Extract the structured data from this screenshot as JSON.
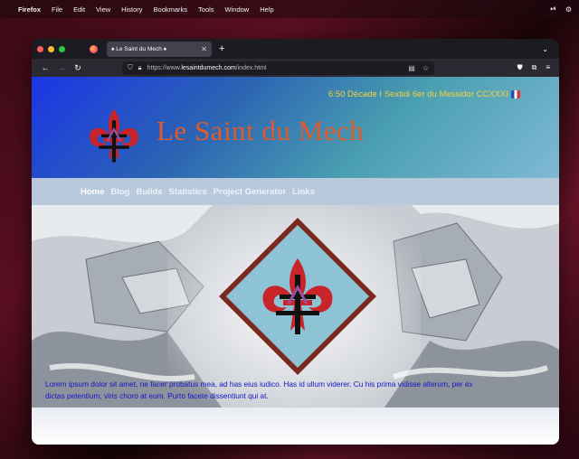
{
  "menubar": {
    "app": "Firefox",
    "items": [
      "File",
      "Edit",
      "View",
      "History",
      "Bookmarks",
      "Tools",
      "Window",
      "Help"
    ]
  },
  "browser": {
    "tab_title": "♠ Le Saint du Mech ♠",
    "url_prefix": "https://www.",
    "url_domain": "lesaintdumech.com",
    "url_path": "/index.html"
  },
  "site": {
    "datetime": "6:50 Décade I Sextidi 6er du Messidor CCXXXI",
    "title": "Le Saint du Mech",
    "nav": [
      "Home",
      "Blog",
      "Builds",
      "Statistics",
      "Project Generator",
      "Links"
    ],
    "lorem": "Lorem ipsum dolor sit amet, ne facer probatus mea, ad has eius iudico. Has id ullum viderer. Cu his prima vidisse alterum, per ex dictas petentium, viris choro at eum. Purto facete dissentiunt qui at."
  },
  "colors": {
    "title": "#e05a2b",
    "datetime": "#f5d33b",
    "lorem": "#1414c8",
    "fleur": "#c8242a",
    "diamond": "#8ec3d6"
  }
}
